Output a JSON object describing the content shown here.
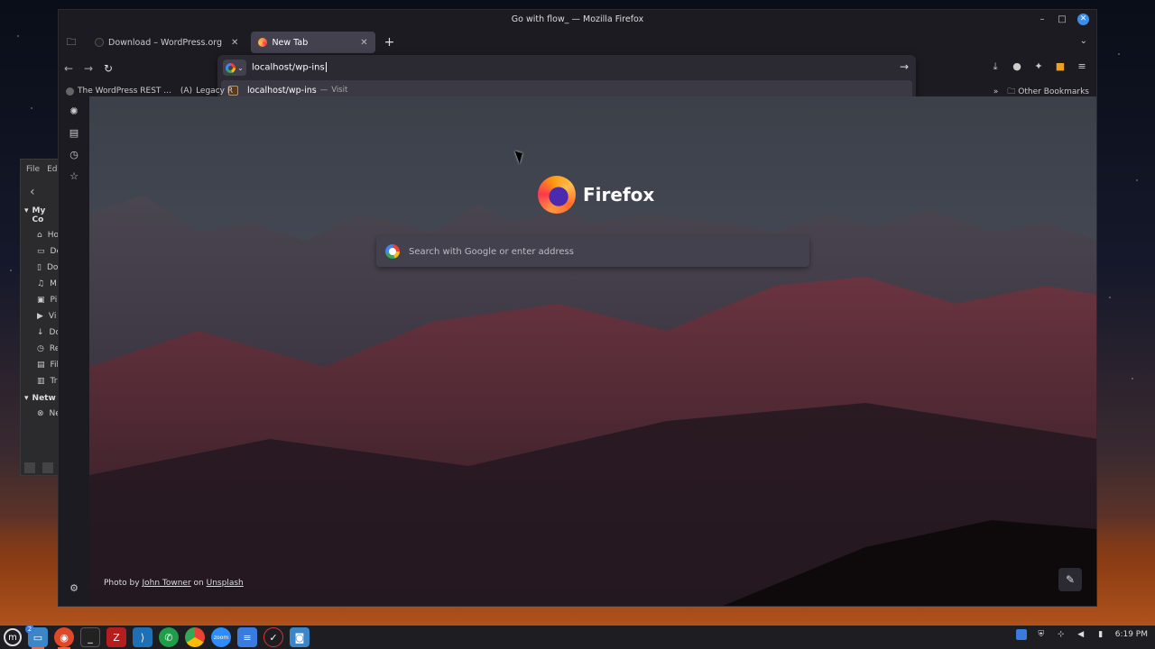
{
  "window": {
    "title": "Go with flow_ — Mozilla Firefox",
    "controls": [
      "–",
      "□",
      "✕"
    ]
  },
  "tabs": [
    {
      "label": "Download – WordPress.org",
      "active": false,
      "close": "✕"
    },
    {
      "label": "New Tab",
      "active": true,
      "close": "✕"
    }
  ],
  "new_tab_label": "+",
  "urlbar": {
    "value": "localhost/wp-ins",
    "suggestion": {
      "text": "localhost/wp-ins",
      "separator": "—",
      "action": "Visit"
    }
  },
  "bookmarks": {
    "items": [
      "The WordPress REST ...",
      "Legacy R"
    ],
    "legacy_icon": "(A)",
    "other": "Other Bookmarks",
    "overflow": "»"
  },
  "newtab": {
    "logo_text": "Firefox",
    "search_placeholder": "Search with Google or enter address",
    "credit": {
      "prefix": "Photo by",
      "author": "John Towner",
      "on": "on",
      "site": "Unsplash"
    }
  },
  "file_manager": {
    "menu": [
      "File",
      "Edi"
    ],
    "sections": [
      "My Co",
      "Netw"
    ],
    "items": [
      "Ho",
      "De",
      "Do",
      "M",
      "Pi",
      "Vi",
      "Do",
      "Re",
      "Fil",
      "Tr"
    ],
    "network_items": [
      "Ne"
    ]
  },
  "taskbar": {
    "badge": "2",
    "clock": "6:19 PM",
    "zoom_label": "zoom"
  },
  "colors": {
    "accent": "#3a8ee6",
    "tab_active": "#42414d",
    "chrome_bg": "#1c1b22"
  }
}
